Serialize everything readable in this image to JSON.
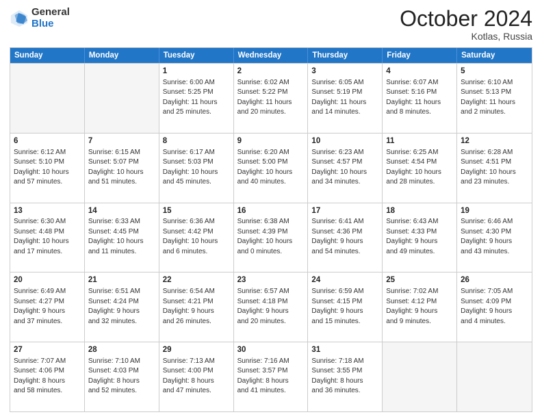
{
  "logo": {
    "general": "General",
    "blue": "Blue"
  },
  "title": {
    "month": "October 2024",
    "location": "Kotlas, Russia"
  },
  "header_days": [
    "Sunday",
    "Monday",
    "Tuesday",
    "Wednesday",
    "Thursday",
    "Friday",
    "Saturday"
  ],
  "weeks": [
    [
      {
        "day": "",
        "info": ""
      },
      {
        "day": "",
        "info": ""
      },
      {
        "day": "1",
        "info": "Sunrise: 6:00 AM\nSunset: 5:25 PM\nDaylight: 11 hours\nand 25 minutes."
      },
      {
        "day": "2",
        "info": "Sunrise: 6:02 AM\nSunset: 5:22 PM\nDaylight: 11 hours\nand 20 minutes."
      },
      {
        "day": "3",
        "info": "Sunrise: 6:05 AM\nSunset: 5:19 PM\nDaylight: 11 hours\nand 14 minutes."
      },
      {
        "day": "4",
        "info": "Sunrise: 6:07 AM\nSunset: 5:16 PM\nDaylight: 11 hours\nand 8 minutes."
      },
      {
        "day": "5",
        "info": "Sunrise: 6:10 AM\nSunset: 5:13 PM\nDaylight: 11 hours\nand 2 minutes."
      }
    ],
    [
      {
        "day": "6",
        "info": "Sunrise: 6:12 AM\nSunset: 5:10 PM\nDaylight: 10 hours\nand 57 minutes."
      },
      {
        "day": "7",
        "info": "Sunrise: 6:15 AM\nSunset: 5:07 PM\nDaylight: 10 hours\nand 51 minutes."
      },
      {
        "day": "8",
        "info": "Sunrise: 6:17 AM\nSunset: 5:03 PM\nDaylight: 10 hours\nand 45 minutes."
      },
      {
        "day": "9",
        "info": "Sunrise: 6:20 AM\nSunset: 5:00 PM\nDaylight: 10 hours\nand 40 minutes."
      },
      {
        "day": "10",
        "info": "Sunrise: 6:23 AM\nSunset: 4:57 PM\nDaylight: 10 hours\nand 34 minutes."
      },
      {
        "day": "11",
        "info": "Sunrise: 6:25 AM\nSunset: 4:54 PM\nDaylight: 10 hours\nand 28 minutes."
      },
      {
        "day": "12",
        "info": "Sunrise: 6:28 AM\nSunset: 4:51 PM\nDaylight: 10 hours\nand 23 minutes."
      }
    ],
    [
      {
        "day": "13",
        "info": "Sunrise: 6:30 AM\nSunset: 4:48 PM\nDaylight: 10 hours\nand 17 minutes."
      },
      {
        "day": "14",
        "info": "Sunrise: 6:33 AM\nSunset: 4:45 PM\nDaylight: 10 hours\nand 11 minutes."
      },
      {
        "day": "15",
        "info": "Sunrise: 6:36 AM\nSunset: 4:42 PM\nDaylight: 10 hours\nand 6 minutes."
      },
      {
        "day": "16",
        "info": "Sunrise: 6:38 AM\nSunset: 4:39 PM\nDaylight: 10 hours\nand 0 minutes."
      },
      {
        "day": "17",
        "info": "Sunrise: 6:41 AM\nSunset: 4:36 PM\nDaylight: 9 hours\nand 54 minutes."
      },
      {
        "day": "18",
        "info": "Sunrise: 6:43 AM\nSunset: 4:33 PM\nDaylight: 9 hours\nand 49 minutes."
      },
      {
        "day": "19",
        "info": "Sunrise: 6:46 AM\nSunset: 4:30 PM\nDaylight: 9 hours\nand 43 minutes."
      }
    ],
    [
      {
        "day": "20",
        "info": "Sunrise: 6:49 AM\nSunset: 4:27 PM\nDaylight: 9 hours\nand 37 minutes."
      },
      {
        "day": "21",
        "info": "Sunrise: 6:51 AM\nSunset: 4:24 PM\nDaylight: 9 hours\nand 32 minutes."
      },
      {
        "day": "22",
        "info": "Sunrise: 6:54 AM\nSunset: 4:21 PM\nDaylight: 9 hours\nand 26 minutes."
      },
      {
        "day": "23",
        "info": "Sunrise: 6:57 AM\nSunset: 4:18 PM\nDaylight: 9 hours\nand 20 minutes."
      },
      {
        "day": "24",
        "info": "Sunrise: 6:59 AM\nSunset: 4:15 PM\nDaylight: 9 hours\nand 15 minutes."
      },
      {
        "day": "25",
        "info": "Sunrise: 7:02 AM\nSunset: 4:12 PM\nDaylight: 9 hours\nand 9 minutes."
      },
      {
        "day": "26",
        "info": "Sunrise: 7:05 AM\nSunset: 4:09 PM\nDaylight: 9 hours\nand 4 minutes."
      }
    ],
    [
      {
        "day": "27",
        "info": "Sunrise: 7:07 AM\nSunset: 4:06 PM\nDaylight: 8 hours\nand 58 minutes."
      },
      {
        "day": "28",
        "info": "Sunrise: 7:10 AM\nSunset: 4:03 PM\nDaylight: 8 hours\nand 52 minutes."
      },
      {
        "day": "29",
        "info": "Sunrise: 7:13 AM\nSunset: 4:00 PM\nDaylight: 8 hours\nand 47 minutes."
      },
      {
        "day": "30",
        "info": "Sunrise: 7:16 AM\nSunset: 3:57 PM\nDaylight: 8 hours\nand 41 minutes."
      },
      {
        "day": "31",
        "info": "Sunrise: 7:18 AM\nSunset: 3:55 PM\nDaylight: 8 hours\nand 36 minutes."
      },
      {
        "day": "",
        "info": ""
      },
      {
        "day": "",
        "info": ""
      }
    ]
  ]
}
